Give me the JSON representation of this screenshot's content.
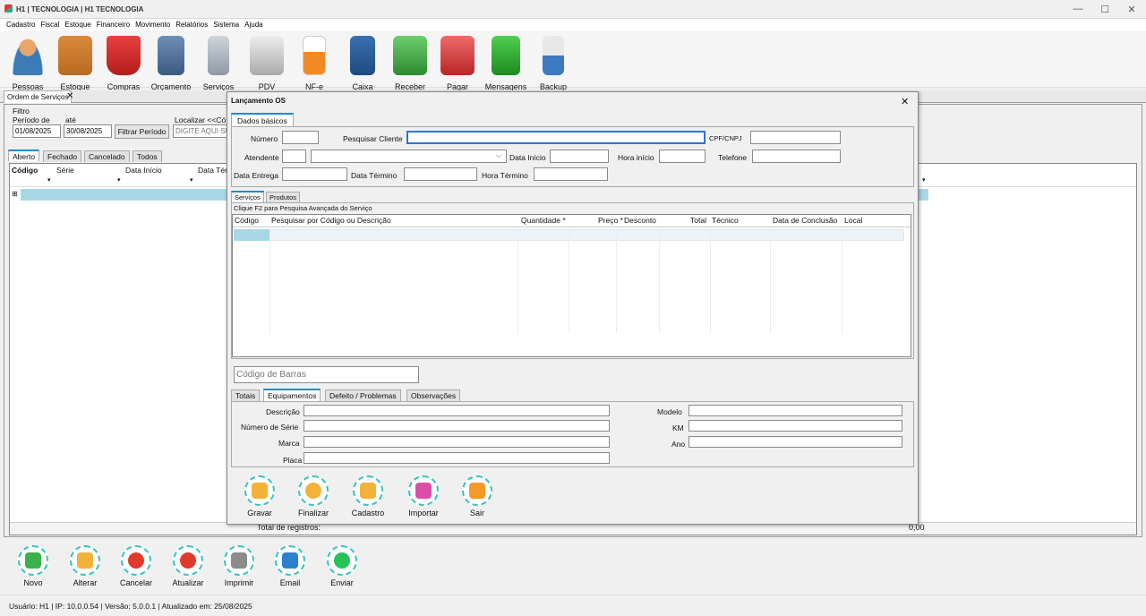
{
  "window": {
    "title": "H1 | TECNOLOGIA | H1 TECNOLOGIA",
    "minimize": "—",
    "maximize": "☐",
    "close": "✕"
  },
  "menu": [
    "Cadastro",
    "Fiscal",
    "Estoque",
    "Financeiro",
    "Movimento",
    "Relatórios",
    "Sistema",
    "Ajuda"
  ],
  "toolbar": [
    {
      "label": "Pessoas",
      "color": "#e07b39"
    },
    {
      "label": "Estoque",
      "color": "#d98b3a"
    },
    {
      "label": "Compras",
      "color": "#d32a2a"
    },
    {
      "label": "Orçamento",
      "color": "#5b7fa8"
    },
    {
      "label": "Serviços",
      "color": "#9aa6b2"
    },
    {
      "label": "PDV",
      "color": "#b9b9b9"
    },
    {
      "label": "NF-e",
      "color": "#f08a24"
    },
    {
      "label": "Caixa",
      "color": "#2a5d9c"
    },
    {
      "label": "Receber",
      "color": "#4aa64a"
    },
    {
      "label": "Pagar",
      "color": "#d94040"
    },
    {
      "label": "Mensagens",
      "color": "#36a836"
    },
    {
      "label": "Backup",
      "color": "#3d7abf"
    }
  ],
  "doc_tab": {
    "label": "Ordem de Serviços",
    "close": "✕"
  },
  "filter": {
    "title": "Filtro",
    "period_from_label": "Período de",
    "period_to_label": "até",
    "date_from": "01/08/2025",
    "date_to": "30/08/2025",
    "filter_button": "Filtrar Período",
    "search_label": "Localizar <<Có",
    "search_placeholder": "DIGITE AQUI SU"
  },
  "status_tabs": [
    "Aberto",
    "Fechado",
    "Cancelado",
    "Todos"
  ],
  "grid": {
    "columns": [
      "Código",
      "Série",
      "Data Início",
      "Data Tér"
    ],
    "total_label": "Total de registros:",
    "total_value": "0,00"
  },
  "dialog": {
    "title": "Lançamento OS",
    "close": "✕",
    "tab_basic": "Dados básicos",
    "numero_label": "Número",
    "pesquisar_cliente_label": "Pesquisar Cliente",
    "cpf_label": "CPF/CNPJ",
    "atendente_label": "Atendente",
    "data_inicio_label": "Data Início",
    "hora_inicio_label": "Hora início",
    "telefone_label": "Telefone",
    "data_entrega_label": "Data Entrega",
    "data_termino_label": "Data Término",
    "hora_termino_label": "Hora Término",
    "item_tabs": [
      "Serviços",
      "Produtos"
    ],
    "hint": "Clique F2 para Pesquisa Avançada do Serviço",
    "item_columns": [
      "Código",
      "Pesquisar por Código ou Descrição",
      "Quantidade *",
      "Preço *",
      "Desconto",
      "Total",
      "Técnico",
      "Data de Conclusão",
      "Local"
    ],
    "barcode_placeholder": "Código de Barras",
    "bottom_tabs": [
      "Totais",
      "Equipamentos",
      "Defeito / Problemas",
      "Observações"
    ],
    "equip": {
      "descricao": "Descrição",
      "numero_serie": "Número de Série",
      "marca": "Marca",
      "placa": "Placa",
      "modelo": "Modelo",
      "km": "KM",
      "ano": "Ano"
    },
    "actions": [
      {
        "label": "Gravar",
        "color": "#f3b23a"
      },
      {
        "label": "Finalizar",
        "color": "#f3b23a"
      },
      {
        "label": "Cadastro",
        "color": "#f3b23a"
      },
      {
        "label": "Importar",
        "color": "#d94fa6"
      },
      {
        "label": "Sair",
        "color": "#f39a2a"
      }
    ]
  },
  "bottom_buttons": [
    {
      "label": "Novo",
      "color": "#3cb34a"
    },
    {
      "label": "Alterar",
      "color": "#f3b23a"
    },
    {
      "label": "Cancelar",
      "color": "#e03a2a"
    },
    {
      "label": "Atualizar",
      "color": "#e03a2a"
    },
    {
      "label": "Imprimir",
      "color": "#8c8c8c"
    },
    {
      "label": "Email",
      "color": "#2f7fd1"
    },
    {
      "label": "Enviar",
      "color": "#25c25a"
    }
  ],
  "statusbar": "Usuário: H1 | IP: 10.0.0.54 | Versão: 5.0.0.1 | Atualizado em: 25/08/2025"
}
